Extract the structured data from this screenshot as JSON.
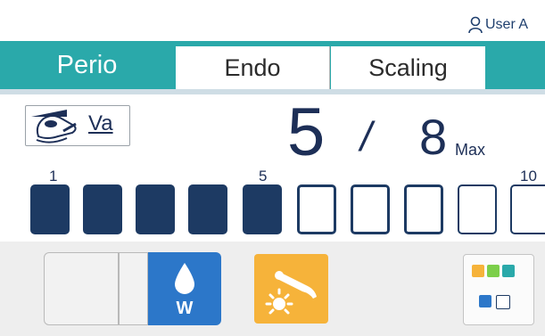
{
  "header": {
    "user_label": "User A",
    "user_icon": "user-icon"
  },
  "tabs": [
    {
      "label": "Perio",
      "active": true
    },
    {
      "label": "Endo",
      "active": false
    },
    {
      "label": "Scaling",
      "active": false
    }
  ],
  "tool": {
    "mode_label": "Va",
    "icon": "handpiece-icon"
  },
  "power": {
    "current": "5",
    "separator": "/",
    "max": "8",
    "max_label": "Max"
  },
  "level_scale": {
    "ticks": [
      "1",
      "5",
      "10"
    ],
    "filled": 5,
    "visible_segments": 10
  },
  "water": {
    "label": "W",
    "icon": "water-drop-icon"
  },
  "light": {
    "icon": "handpiece-light-icon"
  },
  "colors": {
    "teal": "#2aa9aa",
    "navy": "#1d3a63",
    "water_blue": "#2c77c9",
    "light_orange": "#f6b33a"
  }
}
